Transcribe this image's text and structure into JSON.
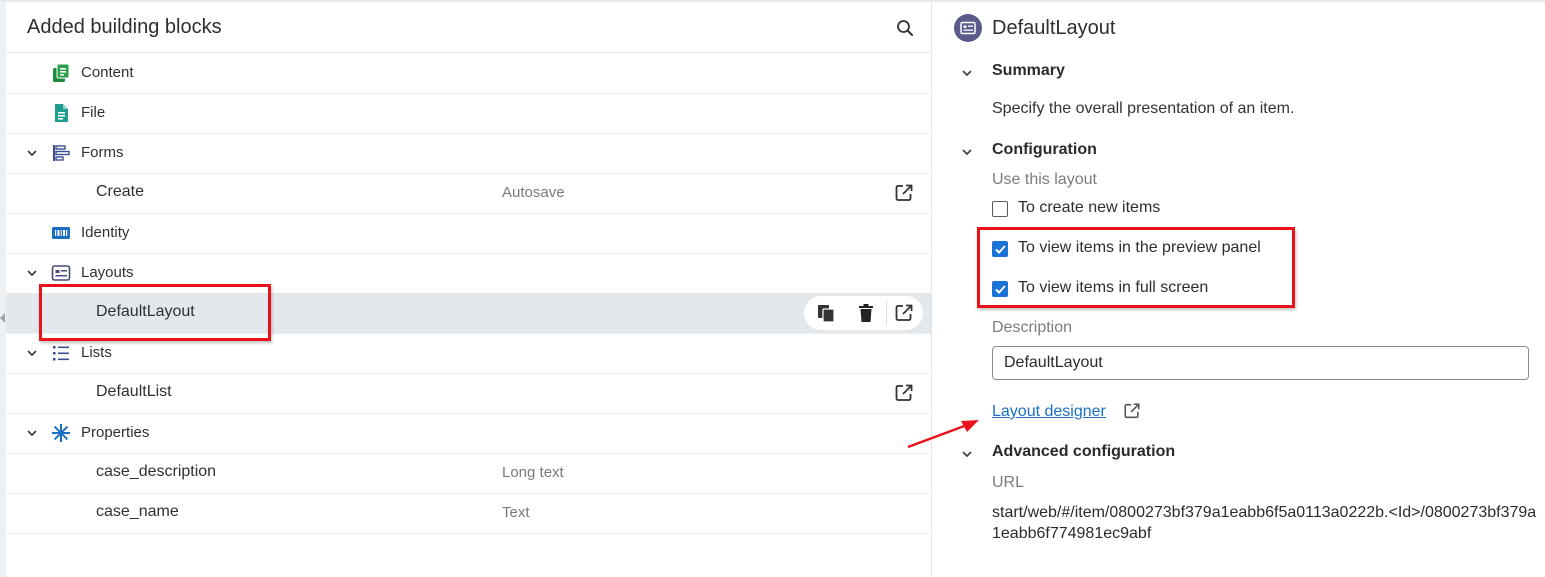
{
  "left_panel": {
    "title": "Added building blocks",
    "items": [
      {
        "label": "Content",
        "type": ""
      },
      {
        "label": "File",
        "type": ""
      },
      {
        "label": "Forms",
        "type": ""
      },
      {
        "label": "Create",
        "type": "Autosave"
      },
      {
        "label": "Identity",
        "type": ""
      },
      {
        "label": "Layouts",
        "type": ""
      },
      {
        "label": "DefaultLayout",
        "type": ""
      },
      {
        "label": "Lists",
        "type": ""
      },
      {
        "label": "DefaultList",
        "type": ""
      },
      {
        "label": "Properties",
        "type": ""
      },
      {
        "label": "case_description",
        "type": "Long text"
      },
      {
        "label": "case_name",
        "type": "Text"
      }
    ]
  },
  "right_panel": {
    "title": "DefaultLayout",
    "summary": {
      "title": "Summary",
      "text": "Specify the overall presentation of an item."
    },
    "configuration": {
      "title": "Configuration",
      "use_label": "Use this layout",
      "options": [
        {
          "label": "To create new items",
          "checked": false
        },
        {
          "label": "To view items in the preview panel",
          "checked": true
        },
        {
          "label": "To view items in full screen",
          "checked": true
        }
      ],
      "description_label": "Description",
      "description_value": "DefaultLayout",
      "designer_link": "Layout designer"
    },
    "advanced": {
      "title": "Advanced configuration",
      "url_label": "URL",
      "url_value": "start/web/#/item/0800273bf379a1eabb6f5a0113a0222b.<Id>/0800273bf379a1eabb6f774981ec9abf"
    }
  },
  "colors": {
    "accent_blue": "#1a73d9",
    "link_blue": "#1a6fc4",
    "highlight_red": "#e8121a",
    "selected_row": "#e3e8ec",
    "layout_icon_bg": "#5b5a8c"
  }
}
